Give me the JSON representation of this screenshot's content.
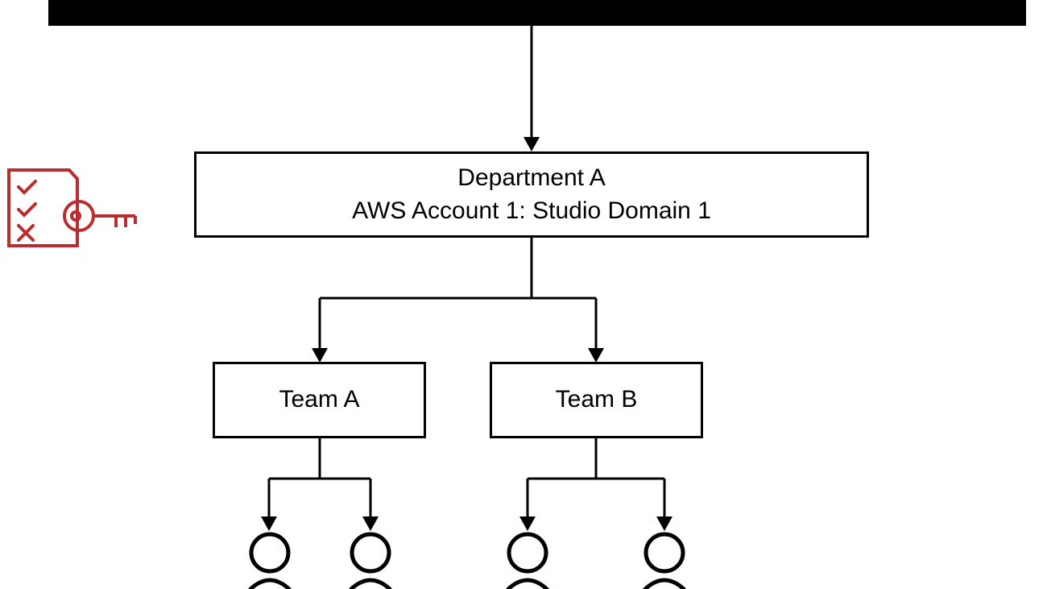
{
  "department": {
    "line1": "Department A",
    "line2": "AWS Account 1: Studio Domain 1"
  },
  "teams": {
    "a": "Team A",
    "b": "Team B"
  },
  "colors": {
    "accent": "#B82E2E",
    "line": "#000000"
  }
}
